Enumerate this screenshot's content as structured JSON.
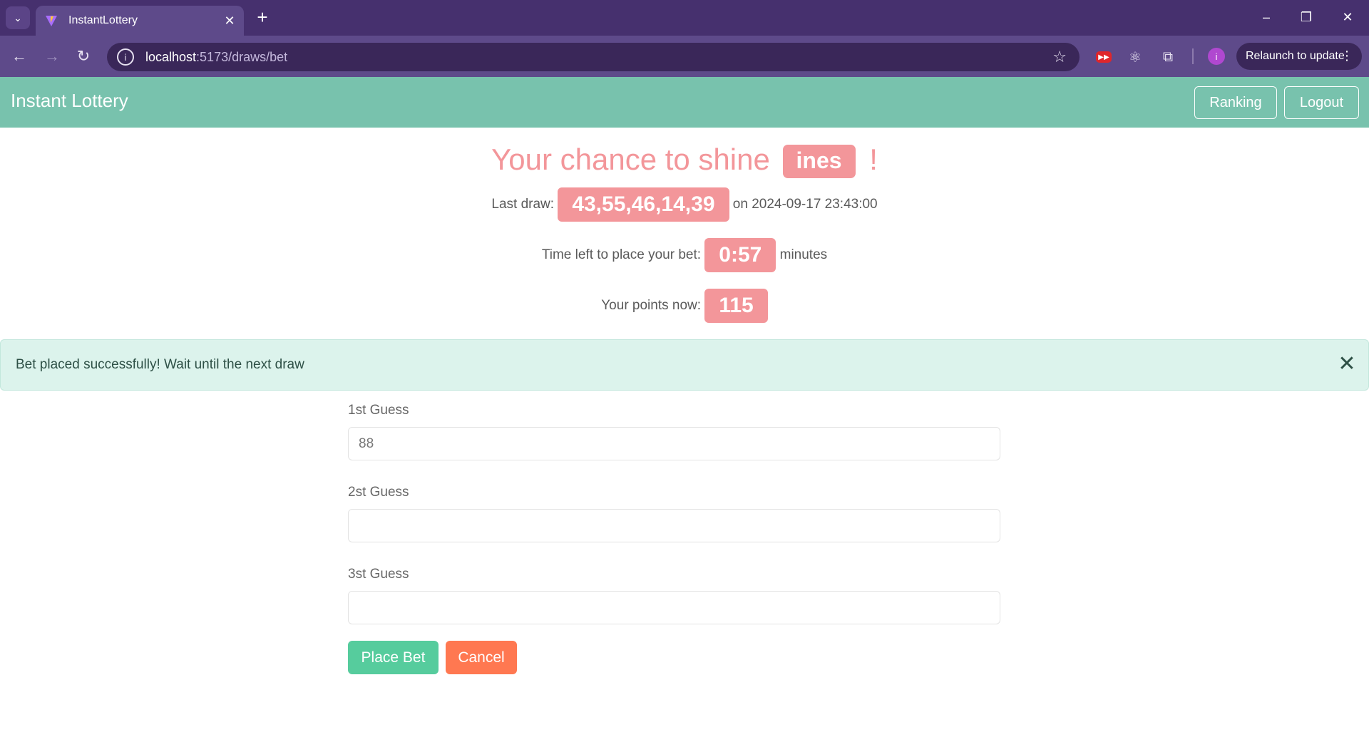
{
  "browser": {
    "tab_title": "InstantLottery",
    "url_host": "localhost",
    "url_path": ":5173/draws/bet",
    "profile_initial": "i",
    "relaunch_label": "Relaunch to update"
  },
  "navbar": {
    "brand": "Instant Lottery",
    "ranking_label": "Ranking",
    "logout_label": "Logout",
    "color": "#78c2ad"
  },
  "hero": {
    "prefix": "Your chance to shine",
    "username": "ines",
    "suffix": "!"
  },
  "last_draw": {
    "label": "Last draw:",
    "numbers": "43,55,46,14,39",
    "date_text": "on 2024-09-17 23:43:00"
  },
  "timer": {
    "label": "Time left to place your bet:",
    "value": "0:57",
    "unit": "minutes"
  },
  "points": {
    "label": "Your points now:",
    "value": "115"
  },
  "alert": {
    "message": "Bet placed successfully! Wait until the next draw"
  },
  "form": {
    "guess1_label": "1st Guess",
    "guess1_value": "88",
    "guess2_label": "2st Guess",
    "guess2_value": "",
    "guess3_label": "3st Guess",
    "guess3_value": "",
    "place_bet_label": "Place Bet",
    "cancel_label": "Cancel"
  },
  "colors": {
    "accent_pink": "#f3969a",
    "success_green": "#56cc9d",
    "cancel_orange": "#ff7851"
  }
}
